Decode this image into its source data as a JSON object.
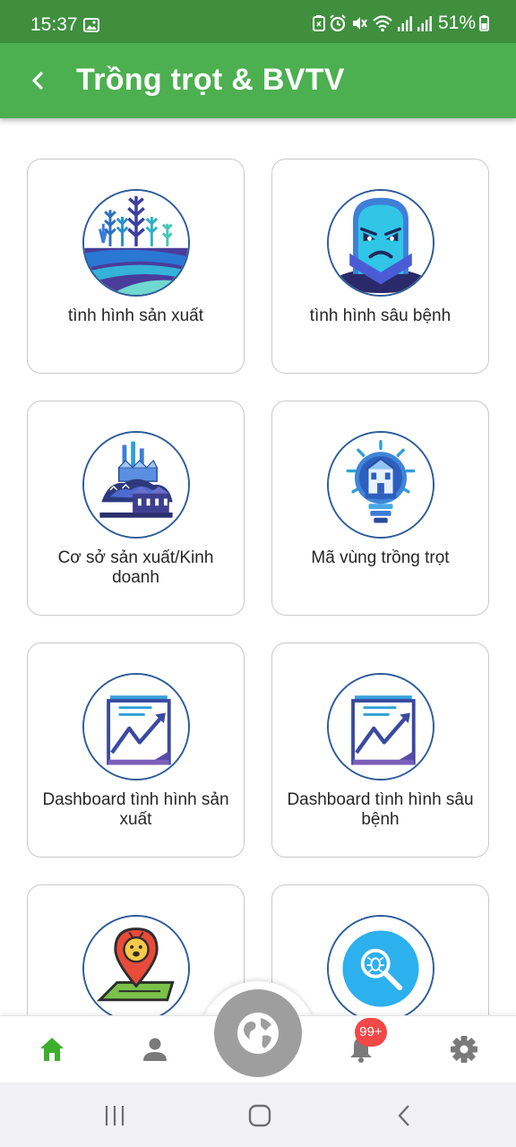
{
  "status_bar": {
    "time": "15:37",
    "battery": "51%",
    "icons": [
      "image-icon",
      "battery-saver-icon",
      "alarm-icon",
      "mute-icon",
      "wifi-icon",
      "signal-icon",
      "signal-icon",
      "battery-icon"
    ]
  },
  "app_bar": {
    "title": "Trồng trọt & BVTV",
    "back_icon": "chevron-left-icon",
    "color": "#4caf50"
  },
  "menu": {
    "items": [
      {
        "label": "tình hình sản xuất",
        "icon": "farm-field-icon"
      },
      {
        "label": "tình hình sâu bệnh",
        "icon": "angry-pest-icon"
      },
      {
        "label": "Cơ sở sản xuất/Kinh doanh",
        "icon": "factory-icon"
      },
      {
        "label": "Mã vùng trồng trọt",
        "icon": "lightbulb-building-icon"
      },
      {
        "label": "Dashboard tình hình sản xuất",
        "icon": "chart-trend-icon"
      },
      {
        "label": "Dashboard tình hình sâu bệnh",
        "icon": "chart-trend-icon"
      },
      {
        "label": "",
        "icon": "map-pin-bug-icon"
      },
      {
        "label": "",
        "icon": "bug-search-icon"
      }
    ]
  },
  "bottom_nav": {
    "items": [
      "home-icon",
      "person-icon",
      "globe-icon",
      "bell-icon",
      "gear-icon"
    ],
    "active_color": "#3daf2c",
    "inactive_color": "#7a7a7a",
    "badge": "99+"
  },
  "system_nav": {
    "items": [
      "recent-apps-icon",
      "home-button-icon",
      "back-icon"
    ]
  }
}
